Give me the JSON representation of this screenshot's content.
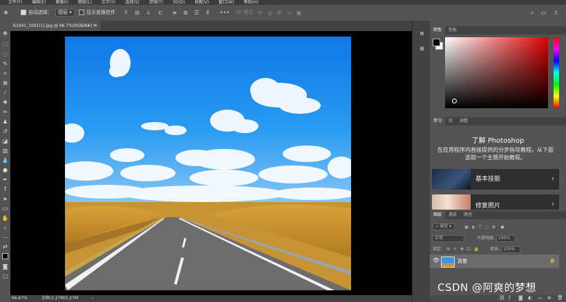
{
  "menu": [
    "文件(F)",
    "编辑(E)",
    "图像(I)",
    "图层(L)",
    "文字(Y)",
    "选择(S)",
    "滤镜(T)",
    "3D(D)",
    "视图(V)",
    "窗口(W)",
    "帮助(H)"
  ],
  "options": {
    "auto_select_label": "自动选择：",
    "auto_select_value": "图层",
    "show_transform_label": "显示变换控件",
    "mode_3d_label": "3D 模式:"
  },
  "document": {
    "tab_label": "61941_1001(1).jpg @ 66.7%(RGB/8#) *",
    "close_glyph": "×",
    "zoom": "66.67%",
    "doc_size": "文档:5.27M/5.27M",
    "status_arrow": "›"
  },
  "color_panel": {
    "tabs": [
      "颜色",
      "色板"
    ],
    "foreground": "#000000",
    "background": "#ffffff"
  },
  "learn_panel": {
    "tabs": [
      "学习",
      "库",
      "调整"
    ],
    "title": "了解 Photoshop",
    "description": "在应用程序内直接提供的分步指导教程。从下面选取一个主题开始教程。",
    "cards": [
      {
        "label": "基本技能",
        "chevron": "›"
      },
      {
        "label": "修复照片",
        "chevron": "›"
      }
    ]
  },
  "layers_panel": {
    "tabs": [
      "图层",
      "通道",
      "路径"
    ],
    "filter_label": "类型",
    "blend_mode": "正常",
    "opacity_label": "不透明度:",
    "opacity_value": "100%",
    "lock_label": "锁定:",
    "fill_label": "填充:",
    "fill_value": "100%",
    "layers": [
      {
        "name": "背景",
        "locked": true
      }
    ]
  },
  "watermark": "CSDN @阿爽的梦想"
}
